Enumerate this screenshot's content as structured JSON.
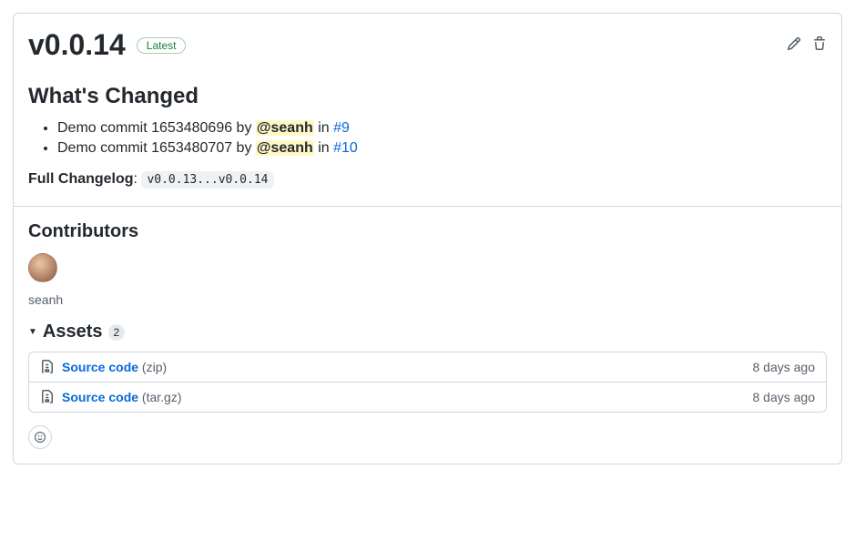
{
  "release": {
    "title": "v0.0.14",
    "badge": "Latest"
  },
  "whats_changed": {
    "heading": "What's Changed",
    "items": [
      {
        "prefix": "Demo commit 1653480696 by ",
        "mention": "@seanh",
        "mid": " in ",
        "pr": "#9"
      },
      {
        "prefix": "Demo commit 1653480707 by ",
        "mention": "@seanh",
        "mid": " in ",
        "pr": "#10"
      }
    ]
  },
  "full_changelog": {
    "label": "Full Changelog",
    "range": "v0.0.13...v0.0.14"
  },
  "contributors": {
    "heading": "Contributors",
    "items": [
      {
        "username": "seanh"
      }
    ]
  },
  "assets": {
    "heading": "Assets",
    "count": "2",
    "items": [
      {
        "name": "Source code",
        "ext": "(zip)",
        "time": "8 days ago"
      },
      {
        "name": "Source code",
        "ext": "(tar.gz)",
        "time": "8 days ago"
      }
    ]
  }
}
